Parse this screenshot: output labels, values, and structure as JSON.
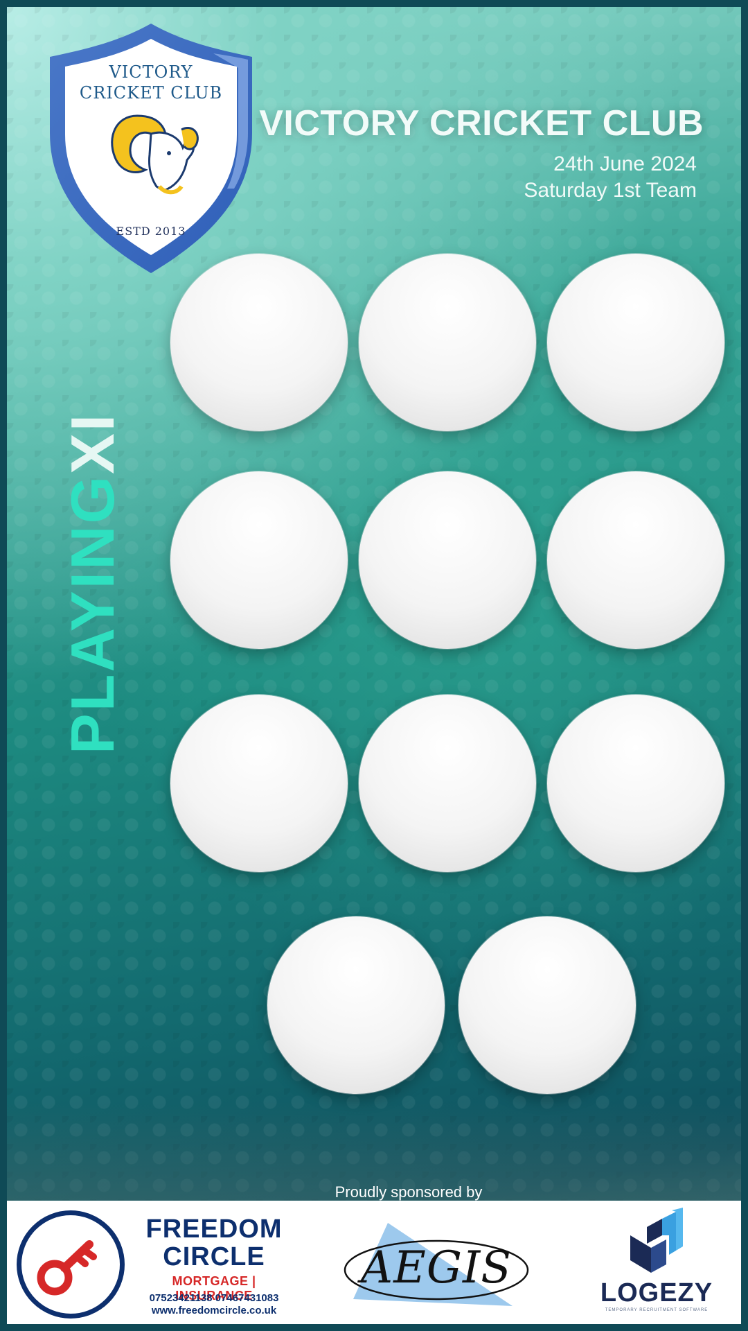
{
  "crest": {
    "line1": "VICTORY",
    "line2": "CRICKET CLUB",
    "estd": "ESTD 2013",
    "emblem_icon": "ram-head-icon"
  },
  "header": {
    "title": "VICTORY CRICKET CLUB",
    "date": "24th June 2024",
    "team": "Saturday 1st Team"
  },
  "side_label": {
    "playing": "PLAYING",
    "xi": "XI"
  },
  "players_count": 11,
  "sponsors": {
    "caption": "Proudly sponsored by",
    "freedom_circle": {
      "name_line1": "FREEDOM",
      "name_line2": "CIRCLE",
      "tagline": "MORTGAGE  |  INSURANCE",
      "phones": "07523421138  07467431083",
      "website": "www.freedomcircle.co.uk",
      "icon": "key-icon"
    },
    "aegis": {
      "name": "AEGIS"
    },
    "logezy": {
      "name": "LOGEZY",
      "subtitle": "TEMPORARY RECRUITMENT SOFTWARE",
      "icon": "cube-icon"
    }
  },
  "colors": {
    "accent_teal": "#2fe0c0",
    "navy": "#0d2f6e",
    "red": "#d62828",
    "border": "#0f4a56"
  }
}
